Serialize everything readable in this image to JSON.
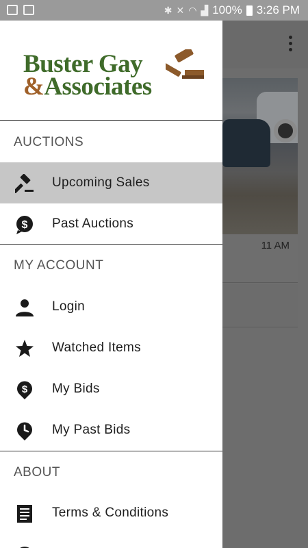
{
  "status_bar": {
    "battery": "100%",
    "time": "3:26 PM"
  },
  "background": {
    "time_fragment": "11 AM"
  },
  "drawer": {
    "logo": {
      "line1": "Buster Gay",
      "amp": "&",
      "line2": "Associates"
    },
    "sections": [
      {
        "title": "AUCTIONS",
        "items": [
          {
            "label": "Upcoming Sales",
            "icon": "gavel-icon",
            "active": true
          },
          {
            "label": "Past Auctions",
            "icon": "dollar-bubble-icon",
            "active": false
          }
        ]
      },
      {
        "title": "MY ACCOUNT",
        "items": [
          {
            "label": "Login",
            "icon": "person-icon"
          },
          {
            "label": "Watched Items",
            "icon": "star-icon"
          },
          {
            "label": "My Bids",
            "icon": "dollar-pin-icon"
          },
          {
            "label": "My Past Bids",
            "icon": "clock-pin-icon"
          }
        ]
      },
      {
        "title": "ABOUT",
        "items": [
          {
            "label": "Terms & Conditions",
            "icon": "document-icon"
          }
        ]
      }
    ]
  },
  "colors": {
    "logo_green": "#3f6b2a",
    "logo_brown": "#a0612a",
    "active_item_bg": "#c6c6c6"
  }
}
